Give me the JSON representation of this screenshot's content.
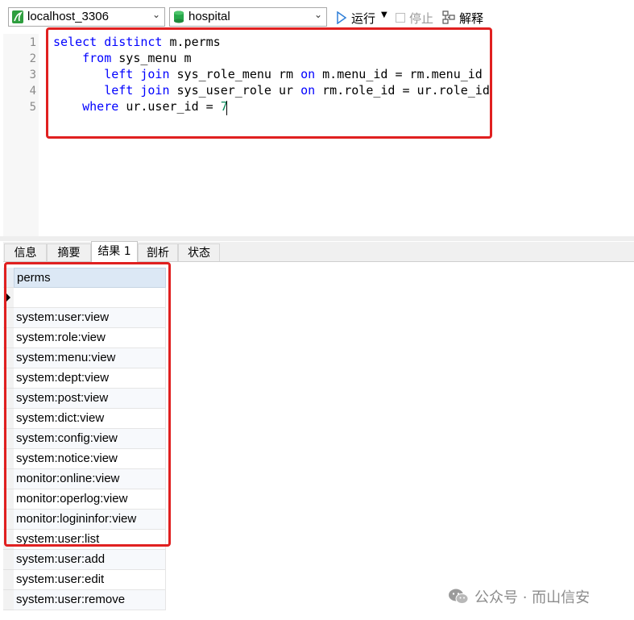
{
  "toolbar": {
    "connection": "localhost_3306",
    "database": "hospital",
    "run_label": "运行",
    "stop_label": "停止",
    "explain_label": "解释"
  },
  "editor": {
    "line_numbers": [
      "1",
      "2",
      "3",
      "4",
      "5"
    ],
    "lines": [
      {
        "indent": "",
        "tokens": [
          [
            "kw",
            "select distinct"
          ],
          [
            "",
            "m.perms"
          ]
        ]
      },
      {
        "indent": "    ",
        "tokens": [
          [
            "kw",
            "from"
          ],
          [
            "",
            "sys_menu m"
          ]
        ]
      },
      {
        "indent": "       ",
        "tokens": [
          [
            "kw",
            "left join"
          ],
          [
            "",
            "sys_role_menu rm "
          ],
          [
            "kw",
            "on"
          ],
          [
            "",
            " m.menu_id = rm.menu_id"
          ]
        ]
      },
      {
        "indent": "       ",
        "tokens": [
          [
            "kw",
            "left join"
          ],
          [
            "",
            "sys_user_role ur "
          ],
          [
            "kw",
            "on"
          ],
          [
            "",
            " rm.role_id = ur.role_id"
          ]
        ]
      },
      {
        "indent": "    ",
        "tokens": [
          [
            "kw",
            "where"
          ],
          [
            "",
            "ur.user_id = "
          ],
          [
            "num",
            "7"
          ]
        ]
      }
    ]
  },
  "result_tabs": [
    "信息",
    "摘要",
    "结果 1",
    "剖析",
    "状态"
  ],
  "active_tab": "结果 1",
  "grid": {
    "column": "perms",
    "rows": [
      "",
      "system:user:view",
      "system:role:view",
      "system:menu:view",
      "system:dept:view",
      "system:post:view",
      "system:dict:view",
      "system:config:view",
      "system:notice:view",
      "monitor:online:view",
      "monitor:operlog:view",
      "monitor:logininfor:view",
      "system:user:list",
      "system:user:add",
      "system:user:edit",
      "system:user:remove"
    ]
  },
  "watermark": "公众号 · 而山信安",
  "colors": {
    "highlight_box": "#e02020",
    "keyword": "#0000ff",
    "number": "#09885a",
    "column_header": "#dce8f5"
  }
}
